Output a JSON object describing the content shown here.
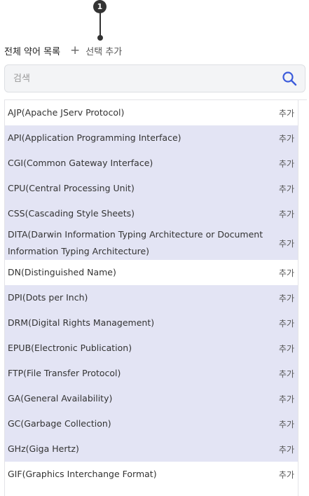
{
  "marker": {
    "number": "1"
  },
  "header": {
    "title": "전체 약어 목록",
    "add_selected_label": "선택 추가"
  },
  "search": {
    "placeholder": "검색"
  },
  "list": {
    "add_label": "추가",
    "items": [
      {
        "name": "AJP(Apache JServ Protocol)",
        "highlight": false
      },
      {
        "name": "API(Application Programming Interface)",
        "highlight": true
      },
      {
        "name": "CGI(Common Gateway Interface)",
        "highlight": true
      },
      {
        "name": "CPU(Central Processing Unit)",
        "highlight": true
      },
      {
        "name": "CSS(Cascading Style Sheets)",
        "highlight": true
      },
      {
        "name": "DITA(Darwin Information Typing Architecture or Document Information Typing Architecture)",
        "highlight": true
      },
      {
        "name": "DN(Distinguished Name)",
        "highlight": false
      },
      {
        "name": "DPI(Dots per Inch)",
        "highlight": true
      },
      {
        "name": "DRM(Digital Rights Management)",
        "highlight": true
      },
      {
        "name": "EPUB(Electronic Publication)",
        "highlight": true
      },
      {
        "name": "FTP(File Transfer Protocol)",
        "highlight": true
      },
      {
        "name": "GA(General Availability)",
        "highlight": true
      },
      {
        "name": "GC(Garbage Collection)",
        "highlight": true
      },
      {
        "name": "GHz(Giga Hertz)",
        "highlight": true
      },
      {
        "name": "GIF(Graphics Interchange Format)",
        "highlight": false
      }
    ]
  },
  "colors": {
    "highlight_row": "#e3e4f4",
    "search_icon": "#3b5bdb"
  }
}
